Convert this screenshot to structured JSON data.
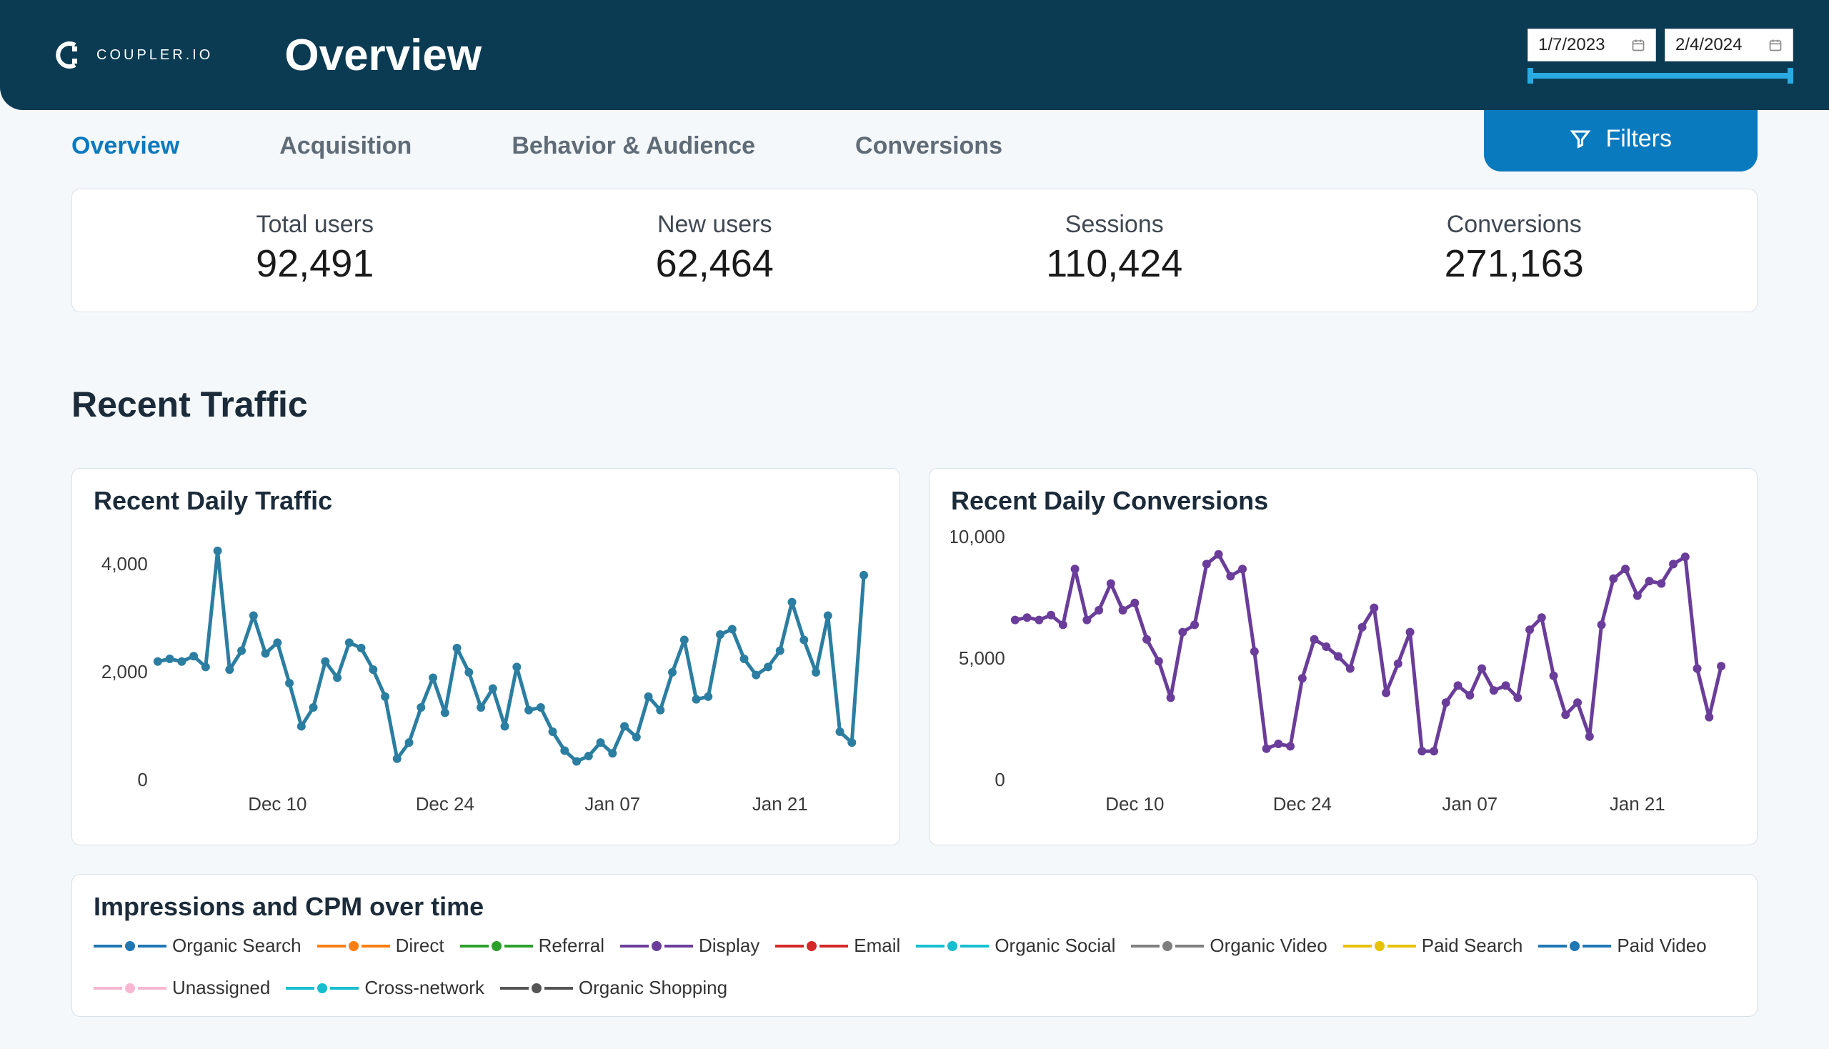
{
  "brand": {
    "name": "COUPLER.IO"
  },
  "page_title": "Overview",
  "date_range": {
    "start": "1/7/2023",
    "end": "2/4/2024"
  },
  "tabs": [
    {
      "label": "Overview",
      "active": true
    },
    {
      "label": "Acquisition",
      "active": false
    },
    {
      "label": "Behavior & Audience",
      "active": false
    },
    {
      "label": "Conversions",
      "active": false
    }
  ],
  "filters_label": "Filters",
  "kpis": [
    {
      "label": "Total users",
      "value": "92,491"
    },
    {
      "label": "New users",
      "value": "62,464"
    },
    {
      "label": "Sessions",
      "value": "110,424"
    },
    {
      "label": "Conversions",
      "value": "271,163"
    }
  ],
  "section_title": "Recent Traffic",
  "chart_traffic_title": "Recent Daily Traffic",
  "chart_conversions_title": "Recent Daily Conversions",
  "impressions_title": "Impressions and CPM over time",
  "legend_series": [
    {
      "name": "Organic Search",
      "color": "#1f77b4"
    },
    {
      "name": "Direct",
      "color": "#ff7f0e"
    },
    {
      "name": "Referral",
      "color": "#2ca02c"
    },
    {
      "name": "Display",
      "color": "#6a3d9a"
    },
    {
      "name": "Email",
      "color": "#d62728"
    },
    {
      "name": "Organic Social",
      "color": "#17becf"
    },
    {
      "name": "Organic Video",
      "color": "#7f7f7f"
    },
    {
      "name": "Paid Search",
      "color": "#e6c200"
    },
    {
      "name": "Paid Video",
      "color": "#1f77b4"
    },
    {
      "name": "Unassigned",
      "color": "#f7b6d2"
    },
    {
      "name": "Cross-network",
      "color": "#17becf"
    },
    {
      "name": "Organic Shopping",
      "color": "#555555"
    }
  ],
  "chart_data": [
    {
      "id": "recent_daily_traffic",
      "type": "line",
      "title": "Recent Daily Traffic",
      "xlabel": "",
      "ylabel": "",
      "ylim": [
        0,
        4500
      ],
      "y_ticks": [
        0,
        2000,
        4000
      ],
      "x_ticks": [
        "Dec 10",
        "Dec 24",
        "Jan 07",
        "Jan 21"
      ],
      "x_tick_index": [
        10,
        24,
        38,
        52
      ],
      "color": "#2b7ea1",
      "series": [
        {
          "name": "Traffic",
          "values": [
            2200,
            2250,
            2200,
            2300,
            2100,
            4250,
            2050,
            2400,
            3050,
            2350,
            2550,
            1800,
            1000,
            1350,
            2200,
            1900,
            2550,
            2450,
            2050,
            1550,
            400,
            700,
            1350,
            1900,
            1250,
            2450,
            2000,
            1350,
            1700,
            1000,
            2100,
            1300,
            1350,
            900,
            550,
            350,
            450,
            700,
            500,
            1000,
            800,
            1550,
            1300,
            2000,
            2600,
            1500,
            1550,
            2700,
            2800,
            2250,
            1950,
            2100,
            2400,
            3300,
            2600,
            2000,
            3050,
            900,
            700,
            3800
          ]
        }
      ]
    },
    {
      "id": "recent_daily_conversions",
      "type": "line",
      "title": "Recent Daily Conversions",
      "xlabel": "",
      "ylabel": "",
      "ylim": [
        0,
        10000
      ],
      "y_ticks": [
        0,
        5000,
        10000
      ],
      "x_ticks": [
        "Dec 10",
        "Dec 24",
        "Jan 07",
        "Jan 21"
      ],
      "x_tick_index": [
        10,
        24,
        38,
        52
      ],
      "color": "#6a3d9a",
      "series": [
        {
          "name": "Conversions",
          "values": [
            6600,
            6700,
            6600,
            6800,
            6400,
            8700,
            6600,
            7000,
            8100,
            7000,
            7300,
            5800,
            4900,
            3400,
            6100,
            6400,
            8900,
            9300,
            8400,
            8700,
            5300,
            1300,
            1500,
            1400,
            4200,
            5800,
            5500,
            5100,
            4600,
            6300,
            7100,
            3600,
            4800,
            6100,
            1200,
            1200,
            3200,
            3900,
            3500,
            4600,
            3700,
            3900,
            3400,
            6200,
            6700,
            4300,
            2700,
            3200,
            1800,
            6400,
            8300,
            8700,
            7600,
            8200,
            8100,
            8900,
            9200,
            4600,
            2600,
            4700
          ]
        }
      ]
    }
  ]
}
